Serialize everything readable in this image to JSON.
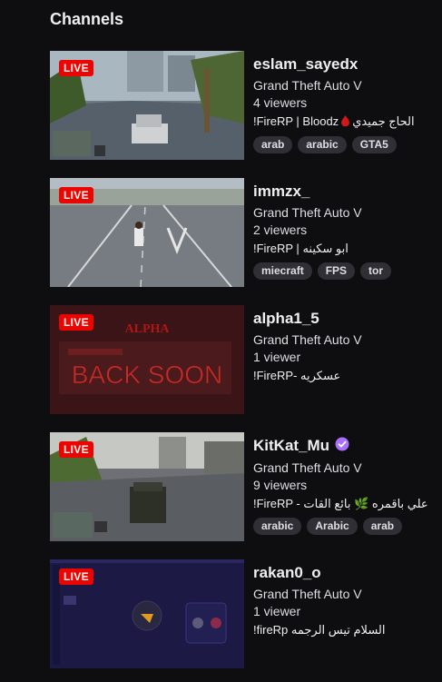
{
  "section": {
    "title": "Channels"
  },
  "live_label": "LIVE",
  "channels": [
    {
      "name": "eslam_sayedx",
      "game": "Grand Theft Auto V",
      "viewers": "4 viewers",
      "title_prefix": "!FireRP | Bloodz",
      "title_suffix": "الحاج جميدي",
      "tags": [
        "arab",
        "arabic",
        "GTA5"
      ]
    },
    {
      "name": "immzx_",
      "game": "Grand Theft Auto V",
      "viewers": "2 viewers",
      "title": "!FireRP | ابو سكينه",
      "tags": [
        "miecraft",
        "FPS",
        "tor"
      ]
    },
    {
      "name": "alpha1_5",
      "game": "Grand Theft Auto V",
      "viewers": "1 viewer",
      "title": "!FireRP- عسكريه",
      "tags": [],
      "thumb_text": "ALPHA",
      "thumb_banner": "BACK SOON"
    },
    {
      "name": "KitKat_Mu",
      "game": "Grand Theft Auto V",
      "viewers": "9 viewers",
      "title": "!FireRP - علي باقمره 🌿 بائع القات",
      "tags": [
        "arabic",
        "Arabic",
        "arab"
      ],
      "verified": true
    },
    {
      "name": "rakan0_o",
      "game": "Grand Theft Auto V",
      "viewers": "1 viewer",
      "title": "!fireRp السلام تيس الرجمه",
      "tags": []
    }
  ],
  "colors": {
    "live_badge": "#eb0400",
    "tag_bg": "#2f2f35",
    "verified": "#a970ff",
    "background": "#0e0e10"
  }
}
